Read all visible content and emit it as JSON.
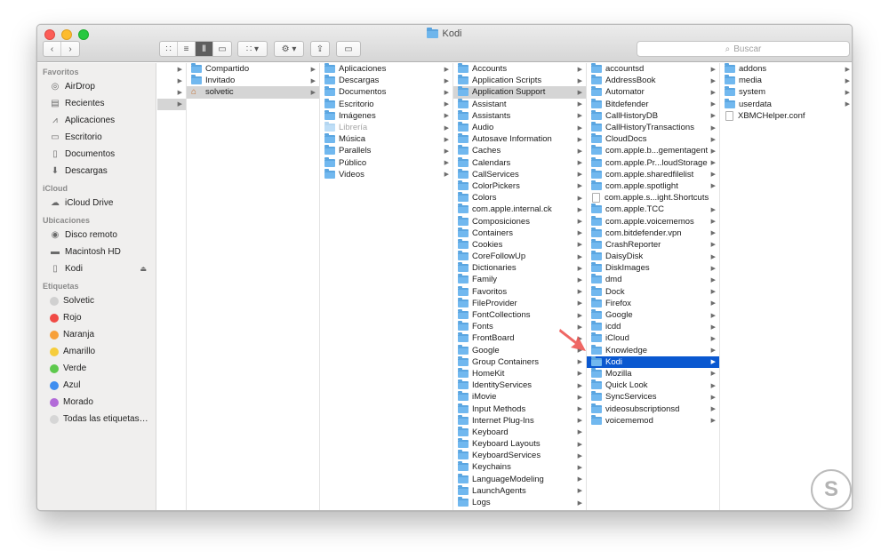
{
  "window": {
    "title": "Kodi"
  },
  "toolbar": {
    "search_placeholder": "Buscar"
  },
  "sidebar": {
    "favoritos_label": "Favoritos",
    "favoritos": [
      {
        "label": "AirDrop",
        "icon": "airdrop-icon"
      },
      {
        "label": "Recientes",
        "icon": "clock-icon"
      },
      {
        "label": "Aplicaciones",
        "icon": "applications-icon"
      },
      {
        "label": "Escritorio",
        "icon": "desktop-icon"
      },
      {
        "label": "Documentos",
        "icon": "document-icon"
      },
      {
        "label": "Descargas",
        "icon": "download-icon"
      }
    ],
    "icloud_label": "iCloud",
    "icloud": [
      {
        "label": "iCloud Drive",
        "icon": "cloud-icon"
      }
    ],
    "ubicaciones_label": "Ubicaciones",
    "ubicaciones": [
      {
        "label": "Disco remoto",
        "icon": "disc-icon"
      },
      {
        "label": "Macintosh HD",
        "icon": "harddisk-icon"
      },
      {
        "label": "Kodi",
        "icon": "drive-icon"
      }
    ],
    "etiquetas_label": "Etiquetas",
    "etiquetas": [
      {
        "label": "Solvetic",
        "color": "#d0d0d0"
      },
      {
        "label": "Rojo",
        "color": "#f04a45"
      },
      {
        "label": "Naranja",
        "color": "#f7a03a"
      },
      {
        "label": "Amarillo",
        "color": "#f6cd3c"
      },
      {
        "label": "Verde",
        "color": "#5ec94d"
      },
      {
        "label": "Azul",
        "color": "#3e8ef0"
      },
      {
        "label": "Morado",
        "color": "#b26bd8"
      },
      {
        "label": "Todas las etiquetas…",
        "color": "#d6d6d6"
      }
    ]
  },
  "columns": {
    "col2": [
      "Compartido",
      "Invitado",
      "solvetic"
    ],
    "col3": [
      "Aplicaciones",
      "Descargas",
      "Documentos",
      "Escritorio",
      "Imágenes",
      "Librería",
      "Música",
      "Parallels",
      "Público",
      "Videos"
    ],
    "col4": [
      "Accounts",
      "Application Scripts",
      "Application Support",
      "Assistant",
      "Assistants",
      "Audio",
      "Autosave Information",
      "Caches",
      "Calendars",
      "CallServices",
      "ColorPickers",
      "Colors",
      "com.apple.internal.ck",
      "Composiciones",
      "Containers",
      "Cookies",
      "CoreFollowUp",
      "Dictionaries",
      "Family",
      "Favoritos",
      "FileProvider",
      "FontCollections",
      "Fonts",
      "FrontBoard",
      "Google",
      "Group Containers",
      "HomeKit",
      "IdentityServices",
      "iMovie",
      "Input Methods",
      "Internet Plug-Ins",
      "Keyboard",
      "Keyboard Layouts",
      "KeyboardServices",
      "Keychains",
      "LanguageModeling",
      "LaunchAgents",
      "Logs"
    ],
    "col5": [
      "accountsd",
      "AddressBook",
      "Automator",
      "Bitdefender",
      "CallHistoryDB",
      "CallHistoryTransactions",
      "CloudDocs",
      "com.apple.b...gementagent",
      "com.apple.Pr...loudStorage",
      "com.apple.sharedfilelist",
      "com.apple.spotlight",
      "com.apple.s...ight.Shortcuts",
      "com.apple.TCC",
      "com.apple.voicememos",
      "com.bitdefender.vpn",
      "CrashReporter",
      "DaisyDisk",
      "DiskImages",
      "dmd",
      "Dock",
      "Firefox",
      "Google",
      "icdd",
      "iCloud",
      "Knowledge",
      "Kodi",
      "Mozilla",
      "Quick Look",
      "SyncServices",
      "videosubscriptionsd",
      "voicememod"
    ],
    "col6": [
      "addons",
      "media",
      "system",
      "userdata",
      "XBMCHelper.conf"
    ]
  }
}
